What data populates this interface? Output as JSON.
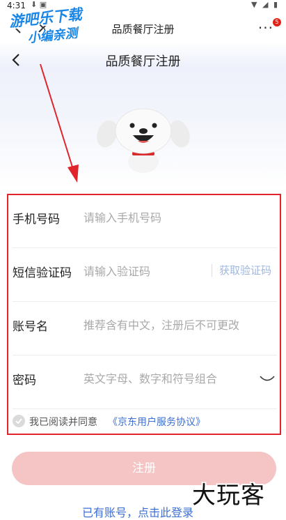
{
  "status_bar": {
    "time": "4:31",
    "icons": "⬇ ▣",
    "right": "▼ ◢ ▮"
  },
  "topbar": {
    "title": "品质餐厅注册",
    "more_label": "···",
    "badge": "5"
  },
  "watermark": {
    "line1": "游吧乐下载",
    "line2": "小编亲测"
  },
  "header": {
    "title": "品质餐厅注册"
  },
  "form": {
    "phone": {
      "label": "手机号码",
      "placeholder": "请输入手机号码"
    },
    "sms": {
      "label": "短信验证码",
      "placeholder": "请输入验证码",
      "code_button": "获取验证码"
    },
    "account": {
      "label": "账号名",
      "placeholder": "推荐含有中文，注册后不可更改"
    },
    "password": {
      "label": "密码",
      "placeholder": "英文字母、数字和符号组合"
    },
    "agreement": {
      "text": "我已阅读并同意",
      "link": "《京东用户服务协议》"
    }
  },
  "register_button": "注册",
  "login_link": "已有账号，点击此登录",
  "corner_watermark": "大玩客",
  "colors": {
    "highlight_box": "#e0242c",
    "register_button": "#f5c4c4",
    "link": "#3b6fd3",
    "code_button": "#9fb7e0"
  }
}
